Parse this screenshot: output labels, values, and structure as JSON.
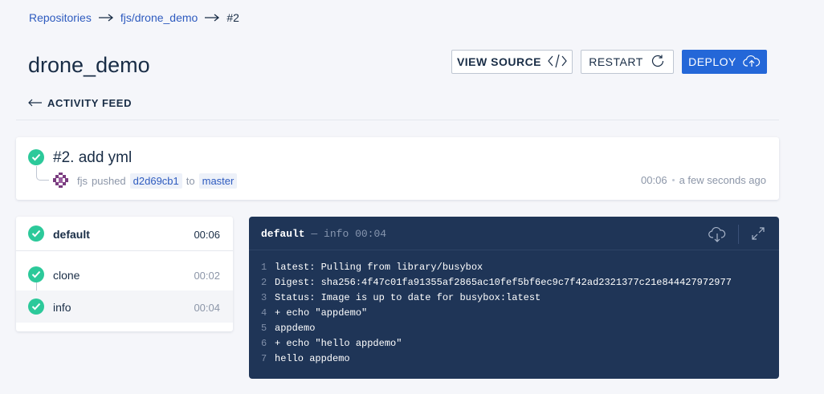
{
  "breadcrumb": {
    "repositories": "Repositories",
    "repo": "fjs/drone_demo",
    "current": "#2"
  },
  "header": {
    "title": "drone_demo",
    "view_source_label": "VIEW SOURCE",
    "restart_label": "RESTART",
    "deploy_label": "DEPLOY",
    "back_label": "ACTIVITY FEED"
  },
  "build": {
    "title": "#2. add yml",
    "author": "fjs",
    "action": "pushed",
    "commit": "d2d69cb1",
    "to": "to",
    "branch": "master",
    "duration": "00:06",
    "when": "a few seconds ago"
  },
  "stage": {
    "name": "default",
    "duration": "00:06",
    "steps": [
      {
        "name": "clone",
        "duration": "00:02"
      },
      {
        "name": "info",
        "duration": "00:04"
      }
    ]
  },
  "log": {
    "stage": "default",
    "dash": "—",
    "step": "info",
    "duration": "00:04",
    "lines": [
      {
        "n": "1",
        "text": "latest: Pulling from library/busybox"
      },
      {
        "n": "2",
        "text": "Digest: sha256:4f47c01fa91355af2865ac10fef5bf6ec9c7f42ad2321377c21e844427972977"
      },
      {
        "n": "3",
        "text": "Status: Image is up to date for busybox:latest"
      },
      {
        "n": "4",
        "text": "+ echo \"appdemo\""
      },
      {
        "n": "5",
        "text": "appdemo"
      },
      {
        "n": "6",
        "text": "+ echo \"hello appdemo\""
      },
      {
        "n": "7",
        "text": "hello appdemo"
      }
    ]
  },
  "colors": {
    "accent": "#2467d8",
    "success": "#2cc99a",
    "log_bg": "#1f3557",
    "link": "#2e5bbf"
  },
  "icons": [
    "arrow-right-icon",
    "code-icon",
    "refresh-icon",
    "cloud-upload-icon",
    "arrow-left-icon",
    "check-icon",
    "avatar-icon",
    "download-cloud-icon",
    "expand-icon"
  ]
}
